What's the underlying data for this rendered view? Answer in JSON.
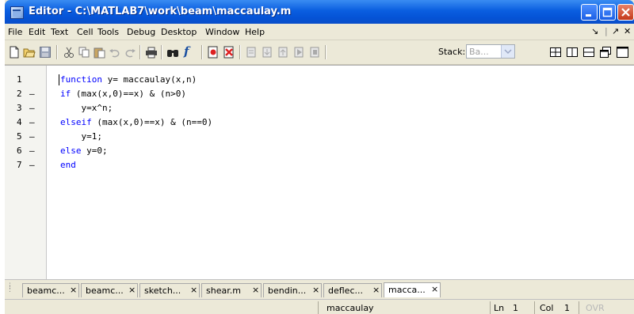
{
  "window": {
    "title": "Editor - C:\\MATLAB7\\work\\beam\\maccaulay.m"
  },
  "menu": {
    "items": [
      "File",
      "Edit",
      "Text",
      "Cell",
      "Tools",
      "Debug",
      "Desktop",
      "Window",
      "Help"
    ],
    "right_glyphs": [
      "↘",
      "|",
      "↗",
      "✕"
    ]
  },
  "toolbar": {
    "icons": [
      "new-file-icon",
      "open-folder-icon",
      "save-icon",
      "cut-icon",
      "copy-icon",
      "paste-icon",
      "undo-icon",
      "redo-icon",
      "print-icon",
      "find-icon",
      "function-icon",
      "set-breakpoint-icon",
      "clear-breakpoint-icon",
      "step-icon",
      "step-in-icon",
      "step-out-icon",
      "continue-icon",
      "exit-debug-icon",
      "tile-grid-icon",
      "tile-vertical-icon",
      "tile-horizontal-icon",
      "float-icon",
      "maximize-icon"
    ],
    "function_glyph": "f",
    "stack_label": "Stack:",
    "stack_value": "Ba..."
  },
  "editor": {
    "lines": [
      {
        "num": "1",
        "bp": "",
        "kw": "function",
        "rest": " y= maccaulay(x,n)"
      },
      {
        "num": "2",
        "bp": "–",
        "kw": "if",
        "rest": " (max(x,0)==x) & (n>0)"
      },
      {
        "num": "3",
        "bp": "–",
        "kw": "",
        "rest": "    y=x^n;"
      },
      {
        "num": "4",
        "bp": "–",
        "kw": "elseif",
        "rest": " (max(x,0)==x) & (n==0)"
      },
      {
        "num": "5",
        "bp": "–",
        "kw": "",
        "rest": "    y=1;"
      },
      {
        "num": "6",
        "bp": "–",
        "kw": "else",
        "rest": " y=0;"
      },
      {
        "num": "7",
        "bp": "–",
        "kw": "end",
        "rest": ""
      }
    ]
  },
  "tabs": [
    {
      "label": "beamc...",
      "close": "×"
    },
    {
      "label": "beamc...",
      "close": "×"
    },
    {
      "label": "sketch...",
      "close": "×"
    },
    {
      "label": "shear.m",
      "close": "×"
    },
    {
      "label": "bendin...",
      "close": "×"
    },
    {
      "label": "deflec...",
      "close": "×"
    },
    {
      "label": "macca...",
      "close": "×"
    }
  ],
  "status": {
    "function_name": "maccaulay",
    "ln_label": "Ln",
    "ln_value": "1",
    "col_label": "Col",
    "col_value": "1",
    "ovr": "OVR"
  }
}
